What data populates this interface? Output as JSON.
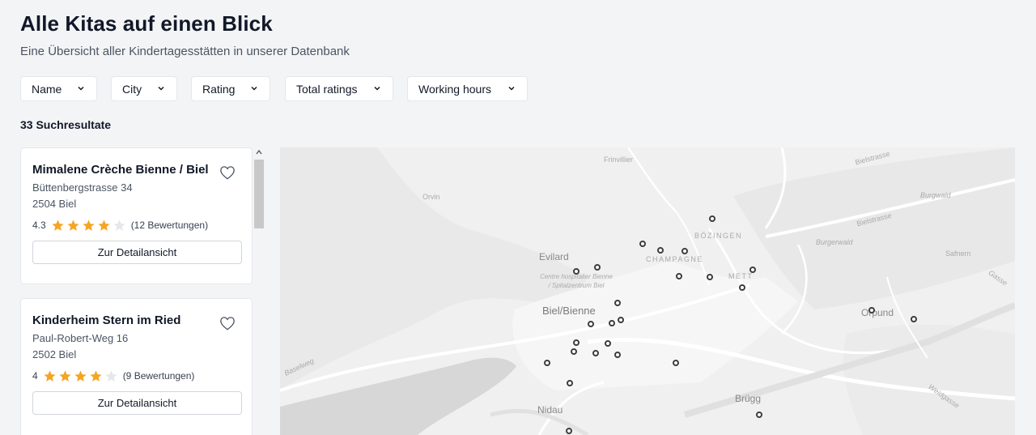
{
  "header": {
    "title": "Alle Kitas auf einen Blick",
    "subtitle": "Eine Übersicht aller Kindertagesstätten in unserer Datenbank"
  },
  "filters": [
    {
      "label": "Name",
      "icon": "chevron-down-icon"
    },
    {
      "label": "City",
      "icon": "chevron-down-icon"
    },
    {
      "label": "Rating",
      "icon": "chevron-down-icon"
    },
    {
      "label": "Total ratings",
      "icon": "chevron-down-icon"
    },
    {
      "label": "Working hours",
      "icon": "chevron-down-icon"
    }
  ],
  "results": {
    "count_label": "33 Suchresultate"
  },
  "kitas": [
    {
      "name": "Mimalene Crèche Bienne / Biel",
      "street": "Büttenbergstrasse 34",
      "city": "2504 Biel",
      "rating_label": "4.3",
      "rating": 4.3,
      "stars_filled": 4,
      "stars_total": 5,
      "ratings_count": "(12 Bewertungen)",
      "button_label": "Zur Detailansicht",
      "favorite_icon": "heart-icon"
    },
    {
      "name": "Kinderheim Stern im Ried",
      "street": "Paul-Robert-Weg 16",
      "city": "2502 Biel",
      "rating_label": "4",
      "rating": 4,
      "stars_filled": 4,
      "stars_total": 5,
      "ratings_count": "(9 Bewertungen)",
      "button_label": "Zur Detailansicht",
      "favorite_icon": "heart-icon"
    }
  ],
  "map": {
    "labels": {
      "frinvillier": "Frinvillier",
      "orvin": "Orvin",
      "bielstrasse_1": "Bielstrasse",
      "burgwald": "Burgwald",
      "bielstrasse_2": "Bielstrasse",
      "bozingen": "BÖZINGEN",
      "burgerwald": "Burgerwald",
      "evilard": "Evilard",
      "champagne": "CHAMPAGNE",
      "safnern": "Safnern",
      "hospital": "Centre hospitalier Bienne / Spitalzentrum Biel",
      "mett": "METT",
      "gasse": "Gasse",
      "biel": "Biel/Bienne",
      "orpund": "Orpund",
      "baselweg": "Baselweg",
      "weidgasse": "Weidgasse",
      "brugg": "Brügg",
      "nidau": "Nidau"
    },
    "colors": {
      "land": "#f0f0f0",
      "lake": "#d7d7d7",
      "roads": "#ffffff",
      "marker_border": "#3d3d3d",
      "star_filled": "#f5a524",
      "star_empty": "#e5e7eb"
    },
    "markers_count": 26
  }
}
